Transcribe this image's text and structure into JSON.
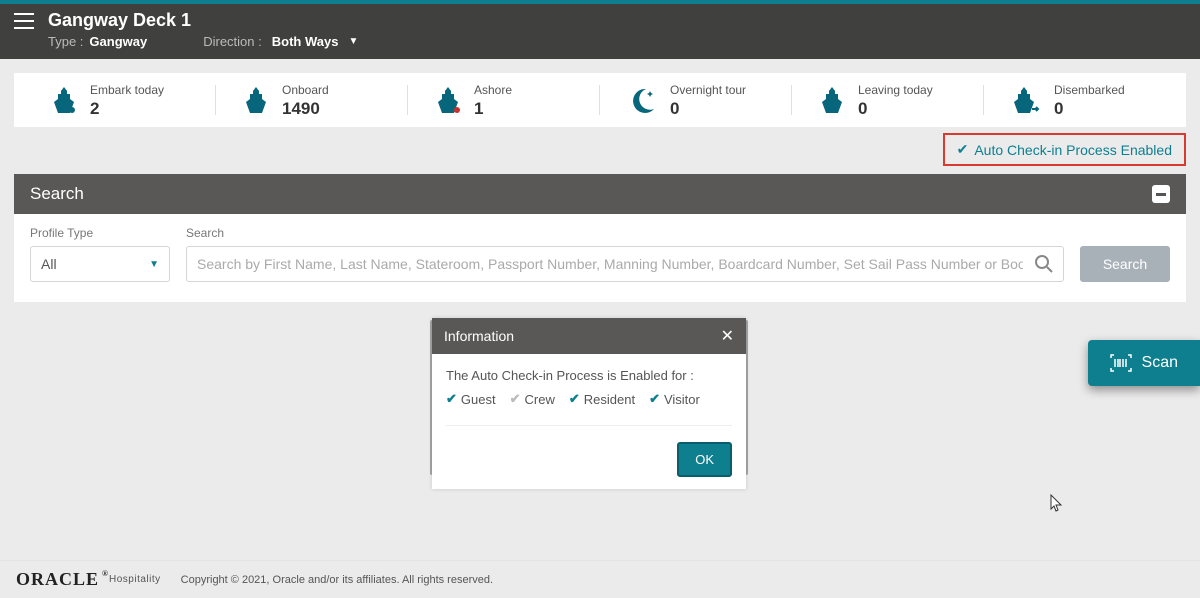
{
  "header": {
    "title": "Gangway Deck 1",
    "type_label": "Type :",
    "type_value": "Gangway",
    "direction_label": "Direction :",
    "direction_value": "Both Ways"
  },
  "stats": [
    {
      "label": "Embark today",
      "value": "2"
    },
    {
      "label": "Onboard",
      "value": "1490"
    },
    {
      "label": "Ashore",
      "value": "1"
    },
    {
      "label": "Overnight tour",
      "value": "0"
    },
    {
      "label": "Leaving today",
      "value": "0"
    },
    {
      "label": "Disembarked",
      "value": "0"
    }
  ],
  "autoCheckin": {
    "label": "Auto Check-in Process Enabled"
  },
  "search": {
    "header": "Search",
    "profile_type_label": "Profile Type",
    "profile_type_value": "All",
    "search_label": "Search",
    "placeholder": "Search by First Name, Last Name, Stateroom, Passport Number, Manning Number, Boardcard Number, Set Sail Pass Number or Booking Number",
    "button": "Search"
  },
  "scan": {
    "label": "Scan"
  },
  "modal": {
    "title": "Information",
    "message": "The Auto Check-in Process is Enabled for :",
    "options": [
      {
        "label": "Guest",
        "enabled": true
      },
      {
        "label": "Crew",
        "enabled": false
      },
      {
        "label": "Resident",
        "enabled": true
      },
      {
        "label": "Visitor",
        "enabled": true
      }
    ],
    "ok": "OK"
  },
  "footer": {
    "brand": "ORACLE",
    "sub": "Hospitality",
    "copyright": "Copyright © 2021, Oracle and/or its affiliates. All rights reserved."
  }
}
